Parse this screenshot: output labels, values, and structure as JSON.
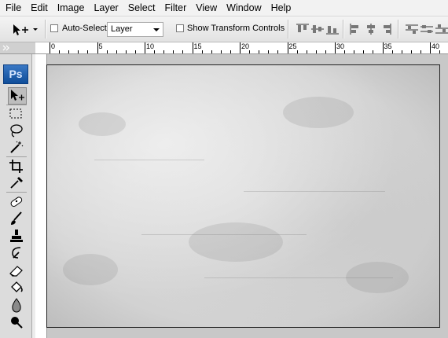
{
  "menu": [
    "File",
    "Edit",
    "Image",
    "Layer",
    "Select",
    "Filter",
    "View",
    "Window",
    "Help"
  ],
  "options": {
    "auto_select_label": "Auto-Select:",
    "auto_select_value": "Layer",
    "show_transform_label": "Show Transform Controls"
  },
  "ruler": {
    "labels": [
      "0",
      "5",
      "10",
      "15",
      "20",
      "25",
      "30",
      "35",
      "40"
    ]
  },
  "toolbox": {
    "logo": "Ps",
    "tools": [
      "move-tool-icon",
      "marquee-tool-icon",
      "lasso-tool-icon",
      "magic-wand-icon",
      "crop-tool-icon",
      "eyedropper-icon",
      "healing-brush-icon",
      "brush-icon",
      "clone-stamp-icon",
      "history-brush-icon",
      "eraser-icon",
      "paint-bucket-icon",
      "blur-icon",
      "dodge-icon"
    ]
  },
  "colors": {
    "logo_blue": "#1a5fb4",
    "canvas_bg": "#c8c8c8"
  }
}
